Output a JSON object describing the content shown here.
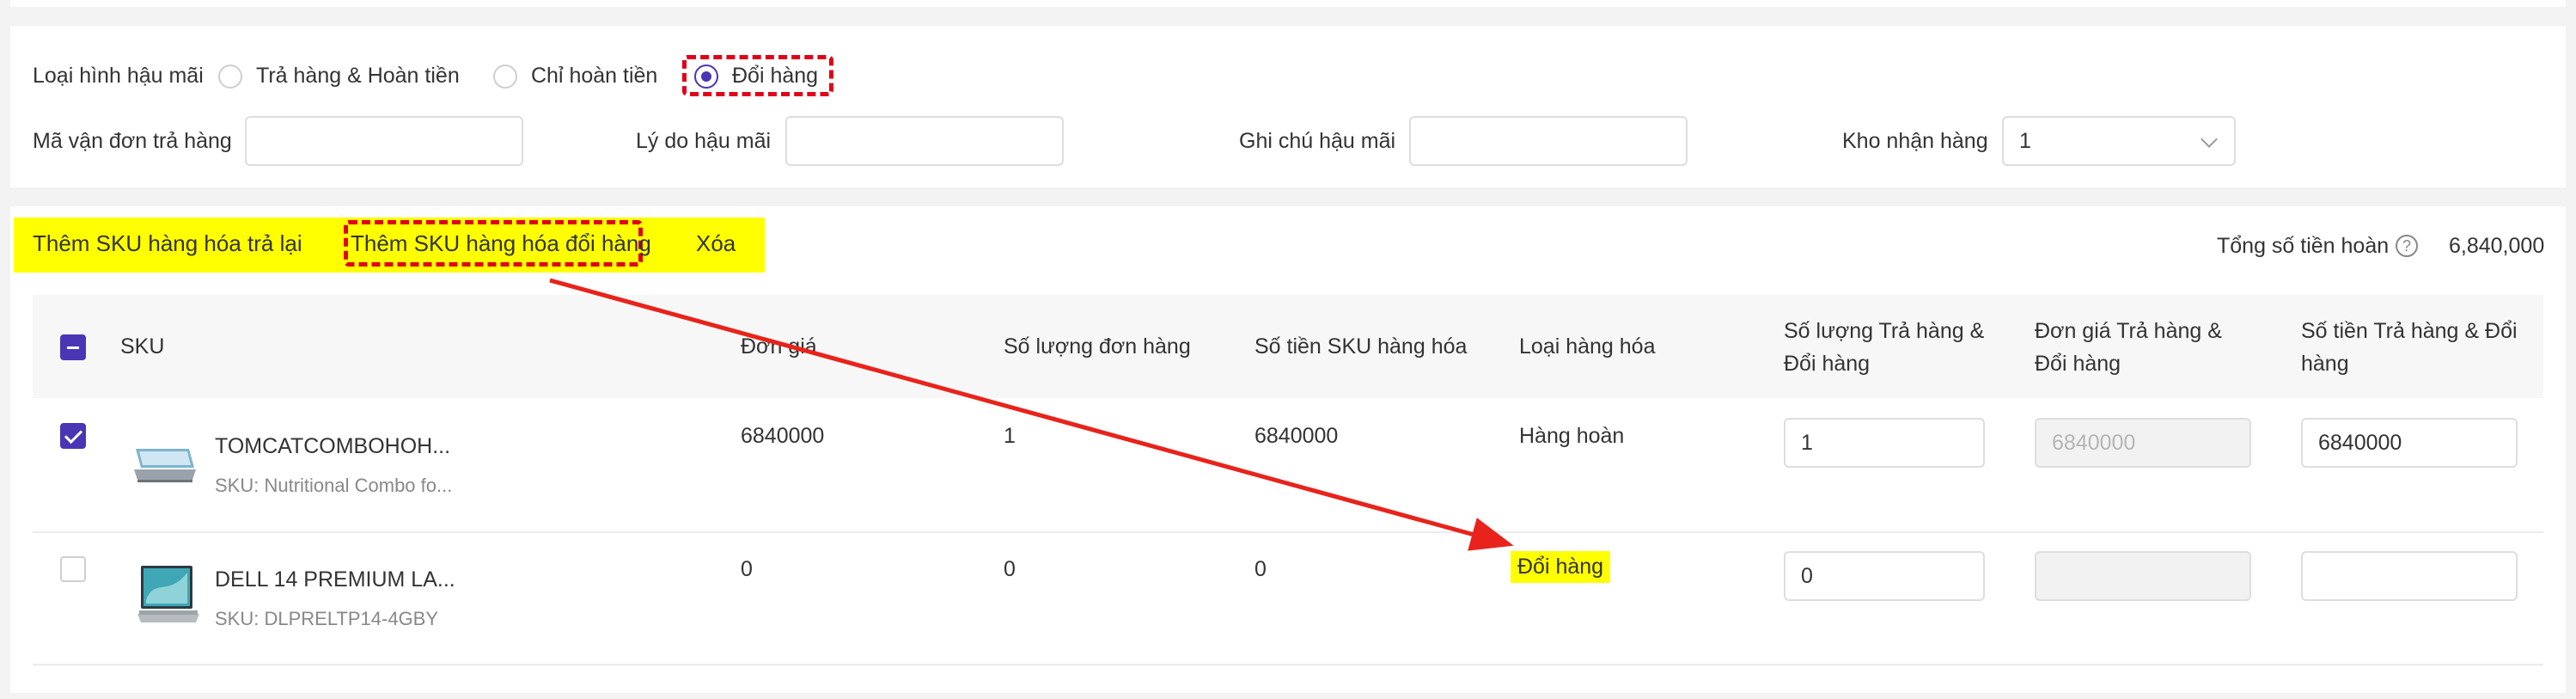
{
  "form": {
    "after_sales_type_label": "Loại hình hậu mãi",
    "options": [
      {
        "label": "Trả hàng & Hoàn tiền",
        "selected": false
      },
      {
        "label": "Chỉ hoàn tiền",
        "selected": false
      },
      {
        "label": "Đổi hàng",
        "selected": true
      }
    ],
    "return_tracking_label": "Mã vận đơn trả hàng",
    "return_tracking_value": "",
    "reason_label": "Lý do hậu mãi",
    "reason_value": "",
    "note_label": "Ghi chú hậu mãi",
    "note_value": "",
    "warehouse_label": "Kho nhận hàng",
    "warehouse_value": "1"
  },
  "toolbar": {
    "add_return_sku": "Thêm SKU hàng hóa trả lại",
    "add_exchange_sku": "Thêm SKU hàng hóa đổi hàng",
    "delete": "Xóa",
    "total_refund_label": "Tổng số tiền hoàn",
    "total_refund_value": "6,840,000"
  },
  "table": {
    "headers": {
      "sku": "SKU",
      "unit_price": "Đơn giá",
      "order_qty": "Số lượng đơn hàng",
      "sku_amount": "Số tiền SKU hàng hóa",
      "item_type": "Loại hàng hóa",
      "return_qty_line1": "Số lượng Trả hàng &",
      "return_qty_line2": "Đổi hàng",
      "return_price_line1": "Đơn giá Trả hàng &",
      "return_price_line2": "Đổi hàng",
      "return_amount_line1": "Số tiền Trả hàng & Đổi",
      "return_amount_line2": "hàng"
    },
    "rows": [
      {
        "checked": true,
        "name": "TOMCATCOMBOHOH...",
        "sku_line": "SKU: Nutritional Combo fo...",
        "unit_price": "6840000",
        "order_qty": "1",
        "sku_amount": "6840000",
        "item_type": "Hàng hoàn",
        "return_qty": "1",
        "return_price": "6840000",
        "return_amount": "6840000"
      },
      {
        "checked": false,
        "name": "DELL 14 PREMIUM LA...",
        "sku_line": "SKU: DLPRELTP14-4GBY",
        "unit_price": "0",
        "order_qty": "0",
        "sku_amount": "0",
        "item_type": "Đổi hàng",
        "return_qty": "0",
        "return_price": "",
        "return_amount": ""
      }
    ]
  },
  "colors": {
    "accent": "#4a35b5",
    "highlight": "#ffff00",
    "annotation_red": "#e0001a"
  },
  "icons": [
    "help-circle-icon",
    "chevron-down-icon",
    "product-thumbnail"
  ]
}
